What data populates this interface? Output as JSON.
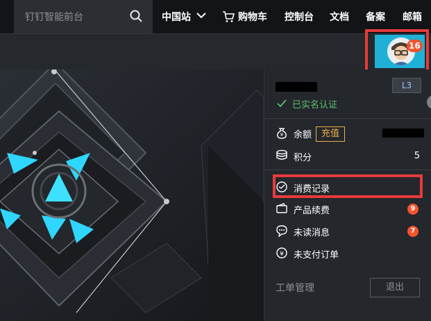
{
  "nav": {
    "search_placeholder": "钉钉智能前台",
    "region": "中国站",
    "cart": "购物车",
    "console": "控制台",
    "docs": "文档",
    "filing": "备案",
    "mail": "邮箱"
  },
  "account": {
    "notification_count": "16",
    "level": "L3",
    "verified": "已实名认证"
  },
  "menu": {
    "balance_label": "余额",
    "topup_label": "充值",
    "points_label": "积分",
    "points_value": "5",
    "consumption_label": "消费记录",
    "renewal_label": "产品续费",
    "renewal_count": "9",
    "messages_label": "未读消息",
    "messages_count": "7",
    "unpaid_label": "未支付订单",
    "workorder_label": "工单管理",
    "logout_label": "退出"
  },
  "colors": {
    "highlight": "#e63b3b",
    "badge": "#f2542d",
    "verified": "#5cc26c",
    "topup": "#f0b14a",
    "avatar_bg": "#1fb0d6"
  }
}
